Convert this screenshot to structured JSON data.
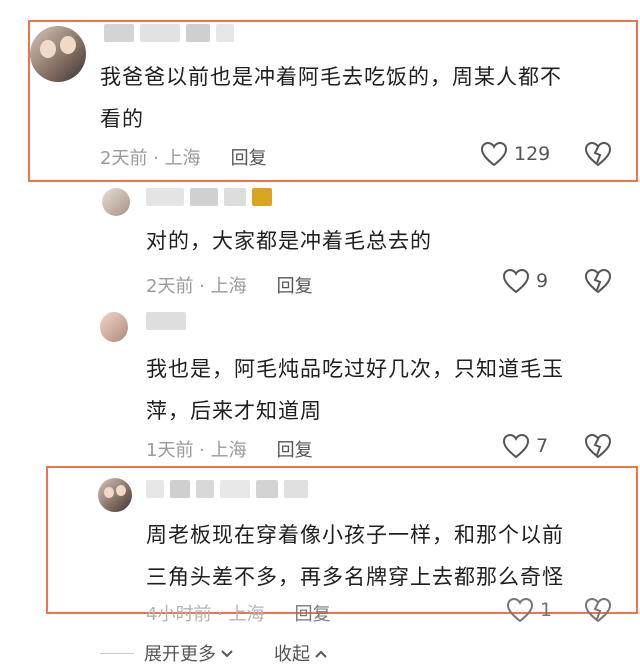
{
  "comments": [
    {
      "text_line1": "我爸爸以前也是冲着阿毛去吃饭的，周某人都不",
      "text_line2": "看的",
      "meta": "2天前 · 上海",
      "reply": "回复",
      "likes": "129"
    },
    {
      "text_line1": "对的，大家都是冲着毛总去的",
      "meta": "2天前 · 上海",
      "reply": "回复",
      "likes": "9"
    },
    {
      "text_line1": "我也是，阿毛炖品吃过好几次，只知道毛玉",
      "text_line2": "萍，后来才知道周",
      "meta": "1天前 · 上海",
      "reply": "回复",
      "likes": "7"
    },
    {
      "text_line1": "周老板现在穿着像小孩子一样，和那个以前",
      "text_line2": "三角头差不多，再多名牌穿上去都那么奇怪",
      "meta": "4小时前 · 上海",
      "reply": "回复",
      "likes": "1"
    }
  ],
  "footer": {
    "expand_more": "展开更多",
    "collapse": "收起"
  },
  "colors": {
    "highlight_border": "#e8774f",
    "meta_gray": "#9a9a9a",
    "badge_gold": "#d9a520"
  },
  "icons": {
    "like": "heart-outline-icon",
    "dislike": "broken-heart-icon",
    "expand": "chevron-down-icon",
    "collapse": "chevron-up-icon"
  }
}
